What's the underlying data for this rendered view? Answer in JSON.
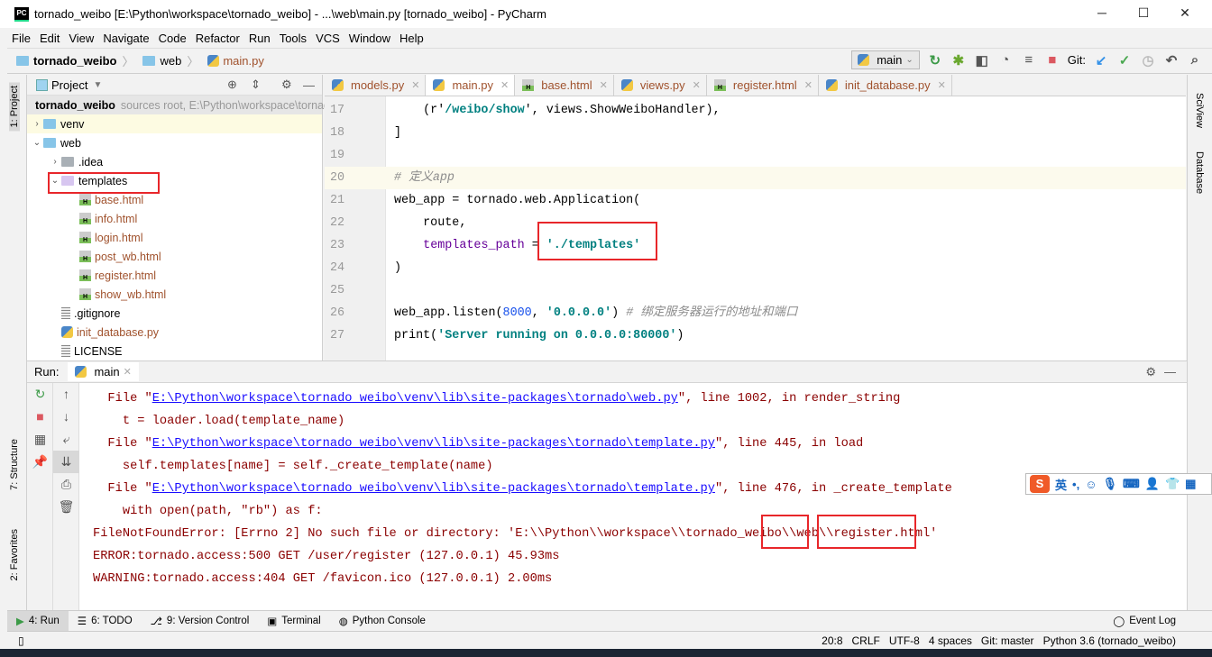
{
  "window": {
    "title": "tornado_weibo [E:\\Python\\workspace\\tornado_weibo] - ...\\web\\main.py [tornado_weibo] - PyCharm",
    "app_icon": "PC"
  },
  "menu": [
    "File",
    "Edit",
    "View",
    "Navigate",
    "Code",
    "Refactor",
    "Run",
    "Tools",
    "VCS",
    "Window",
    "Help"
  ],
  "breadcrumb": [
    "tornado_weibo",
    "web",
    "main.py"
  ],
  "toolbar": {
    "run_config": "main",
    "git_label": "Git:"
  },
  "left_strip": [
    "1: Project",
    "7: Structure",
    "2: Favorites"
  ],
  "right_strip": [
    "SciView",
    "Database"
  ],
  "project": {
    "header": "Project",
    "root": {
      "name": "tornado_weibo",
      "hint": "sources root,  E:\\Python\\workspace\\tornado_weibo"
    },
    "items": [
      {
        "name": "venv",
        "type": "folder",
        "depth": 1,
        "arrow": "›"
      },
      {
        "name": "web",
        "type": "folder",
        "depth": 1,
        "arrow": "⌄"
      },
      {
        "name": ".idea",
        "type": "folder-gray",
        "depth": 2,
        "arrow": "›"
      },
      {
        "name": "templates",
        "type": "folder-purple",
        "depth": 2,
        "arrow": "⌄"
      },
      {
        "name": "base.html",
        "type": "html",
        "depth": 3
      },
      {
        "name": "info.html",
        "type": "html",
        "depth": 3
      },
      {
        "name": "login.html",
        "type": "html",
        "depth": 3
      },
      {
        "name": "post_wb.html",
        "type": "html",
        "depth": 3
      },
      {
        "name": "register.html",
        "type": "html",
        "depth": 3
      },
      {
        "name": "show_wb.html",
        "type": "html",
        "depth": 3
      },
      {
        "name": ".gitignore",
        "type": "text",
        "depth": 2
      },
      {
        "name": "init_database.py",
        "type": "py",
        "depth": 2
      },
      {
        "name": "LICENSE",
        "type": "text",
        "depth": 2
      }
    ]
  },
  "editor_tabs": [
    {
      "label": "models.py",
      "icon": "py"
    },
    {
      "label": "main.py",
      "icon": "py",
      "active": true
    },
    {
      "label": "base.html",
      "icon": "html"
    },
    {
      "label": "views.py",
      "icon": "py"
    },
    {
      "label": "register.html",
      "icon": "html"
    },
    {
      "label": "init_database.py",
      "icon": "py"
    }
  ],
  "code": [
    {
      "n": "17",
      "segs": [
        [
          "    (r'",
          ""
        ],
        [
          "/weibo/show",
          "c-str"
        ],
        [
          "', views.ShowWeiboHandler),",
          ""
        ]
      ]
    },
    {
      "n": "18",
      "segs": [
        [
          "]",
          ""
        ]
      ]
    },
    {
      "n": "19",
      "segs": []
    },
    {
      "n": "20",
      "cur": true,
      "segs": [
        [
          "# 定义app",
          "c-cmt"
        ]
      ]
    },
    {
      "n": "21",
      "segs": [
        [
          "web_app = tornado.web.Application(",
          ""
        ]
      ]
    },
    {
      "n": "22",
      "segs": [
        [
          "    route,",
          ""
        ]
      ]
    },
    {
      "n": "23",
      "segs": [
        [
          "    ",
          ""
        ],
        [
          "templates_path",
          "c-param"
        ],
        [
          " = ",
          ""
        ],
        [
          "'./templates'",
          "c-str"
        ]
      ]
    },
    {
      "n": "24",
      "segs": [
        [
          ")",
          ""
        ]
      ]
    },
    {
      "n": "25",
      "segs": []
    },
    {
      "n": "26",
      "segs": [
        [
          "web_app.listen(",
          ""
        ],
        [
          "8000",
          "c-num"
        ],
        [
          ", ",
          ""
        ],
        [
          "'0.0.0.0'",
          "c-str"
        ],
        [
          ") ",
          ""
        ],
        [
          "# 绑定服务器运行的地址和端口",
          "c-cmt"
        ]
      ]
    },
    {
      "n": "27",
      "segs": [
        [
          "print(",
          ""
        ],
        [
          "'Server running on 0.0.0.0:80000'",
          "c-str"
        ],
        [
          ")",
          ""
        ]
      ]
    }
  ],
  "run": {
    "label": "Run:",
    "tab": "main",
    "output": [
      [
        [
          "  File \"",
          ""
        ],
        [
          "E:\\Python\\workspace\\tornado_weibo\\venv\\lib\\site-packages\\tornado\\web.py",
          "o-link"
        ],
        [
          "\", line 1002, in render_string",
          ""
        ]
      ],
      [
        [
          "    t = loader.load(template_name)",
          ""
        ]
      ],
      [
        [
          "  File \"",
          ""
        ],
        [
          "E:\\Python\\workspace\\tornado_weibo\\venv\\lib\\site-packages\\tornado\\template.py",
          "o-link"
        ],
        [
          "\", line 445, in load",
          ""
        ]
      ],
      [
        [
          "    self.templates[name] = self._create_template(name)",
          ""
        ]
      ],
      [
        [
          "  File \"",
          ""
        ],
        [
          "E:\\Python\\workspace\\tornado_weibo\\venv\\lib\\site-packages\\tornado\\template.py",
          "o-link"
        ],
        [
          "\", line 476, in _create_template",
          ""
        ]
      ],
      [
        [
          "    with open(path, \"rb\") as f:",
          ""
        ]
      ],
      [
        [
          "FileNotFoundError: [Errno 2] No such file or directory: 'E:\\\\Python\\\\workspace\\\\tornado_weibo\\\\web\\\\register.html'",
          ""
        ]
      ],
      [
        [
          "ERROR:tornado.access:500 GET /user/register (127.0.0.1) 45.93ms",
          ""
        ]
      ],
      [
        [
          "WARNING:tornado.access:404 GET /favicon.ico (127.0.0.1) 2.00ms",
          ""
        ]
      ]
    ]
  },
  "bottom_tabs": [
    "4: Run",
    "6: TODO",
    "9: Version Control",
    "Terminal",
    "Python Console"
  ],
  "event_log": "Event Log",
  "status": {
    "position": "20:8",
    "line_sep": "CRLF",
    "encoding": "UTF-8",
    "indent": "4 spaces",
    "git": "Git: master",
    "interpreter": "Python 3.6 (tornado_weibo)"
  },
  "ime": {
    "lang": "英",
    "punct": "•,"
  }
}
